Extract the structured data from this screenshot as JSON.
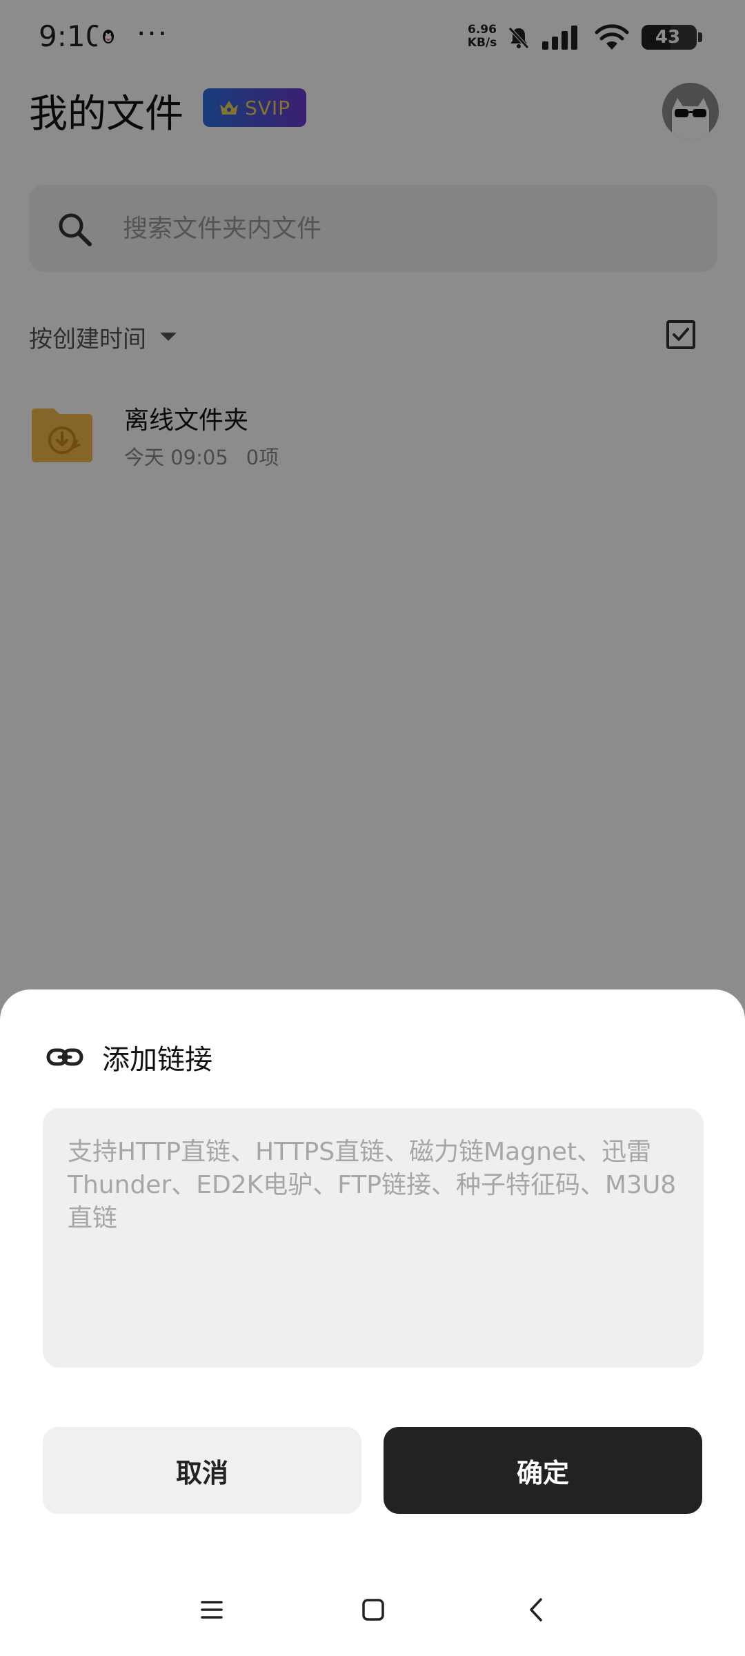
{
  "status_bar": {
    "time": "9:10",
    "dots": "···",
    "net_speed_value": "6.96",
    "net_speed_unit": "KB/s",
    "battery": "43"
  },
  "header": {
    "title": "我的文件",
    "badge": "SVIP"
  },
  "search": {
    "placeholder": "搜索文件夹内文件"
  },
  "sort": {
    "label": "按创建时间"
  },
  "files": [
    {
      "name": "离线文件夹",
      "date": "今天 09:05",
      "count": "0项"
    }
  ],
  "dialog": {
    "title": "添加链接",
    "input_value": "",
    "input_placeholder": "支持HTTP直链、HTTPS直链、磁力链Magnet、迅雷Thunder、ED2K电驴、FTP链接、种子特征码、M3U8直链",
    "cancel_label": "取消",
    "confirm_label": "确定"
  },
  "colors": {
    "overlay": "rgba(0,0,0,0.45)",
    "confirm_button": "#222222",
    "svip_gradient_start": "#2d6fe0",
    "svip_gradient_end": "#6a3ad0",
    "folder": "#f2b84b"
  },
  "icons": {
    "status": [
      "qq-icon",
      "bell-muted-icon",
      "signal-icon",
      "wifi-icon",
      "battery-icon"
    ],
    "header": [
      "crown-icon",
      "avatar"
    ],
    "search": "search-icon",
    "sort": "caret-down-icon",
    "select": "checkbox-icon",
    "folder": "offline-folder-icon",
    "dialog": "link-icon",
    "nav": [
      "menu-icon",
      "home-icon",
      "back-icon"
    ]
  }
}
